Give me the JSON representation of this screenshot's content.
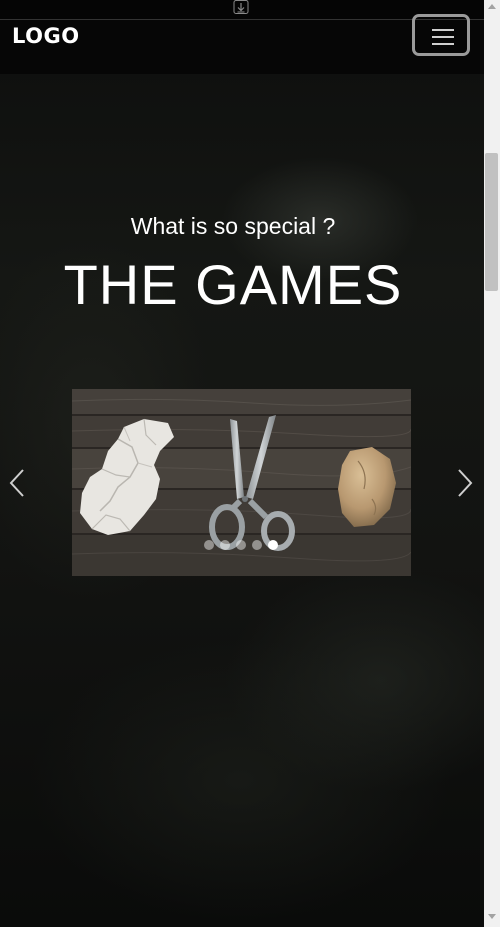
{
  "navbar": {
    "logo": "LOGO",
    "menu_icon": "hamburger-menu-icon"
  },
  "hero": {
    "subtitle": "What is so special ?",
    "title": "THE GAMES"
  },
  "carousel": {
    "image": "rock-paper-scissors-on-wood",
    "slide_count": 5,
    "active_index": 4,
    "prev_icon": "chevron-left-icon",
    "next_icon": "chevron-right-icon"
  },
  "colors": {
    "background": "#0d0e0d",
    "text": "#ffffff",
    "menu_border": "#9a9a9a"
  }
}
